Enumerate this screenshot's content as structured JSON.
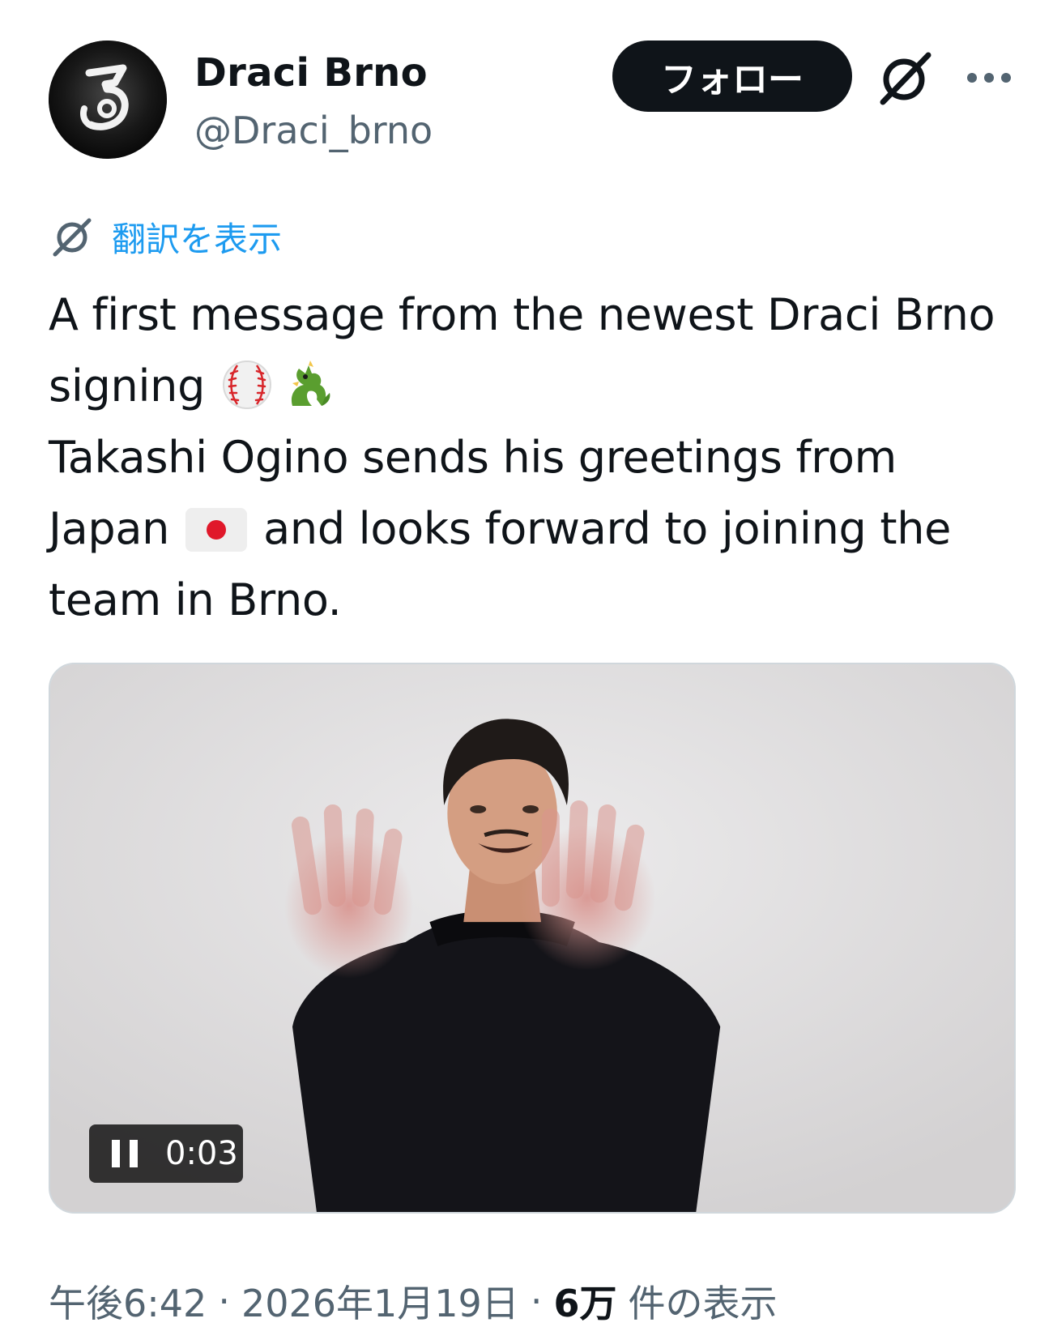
{
  "author": {
    "display_name": "Draci Brno",
    "handle": "@Draci_brno",
    "avatar_icon": "draci-brno-logo"
  },
  "header": {
    "follow_label": "フォロー",
    "grok_icon": "grok-icon",
    "more_icon": "more-horizontal-icon"
  },
  "translate": {
    "icon": "grok-translate-icon",
    "label": "翻訳を表示",
    "color": "#1d9bf0"
  },
  "tweet": {
    "line1": "A first message from the newest Draci Brno",
    "line2": "signing",
    "line3": "Takashi Ogino sends his greetings from",
    "line4_before": "Japan",
    "line4_after": "and looks forward to joining the",
    "line5": "team in Brno.",
    "emojis": [
      "baseball",
      "dragon",
      "flag-japan"
    ]
  },
  "media": {
    "type": "video",
    "state": "playing",
    "control_icon": "pause-icon",
    "elapsed": "0:03"
  },
  "meta": {
    "time": "午後6:42",
    "separator": "·",
    "date": "2026年1月19日",
    "views_count": "6万",
    "views_label": "件の表示"
  },
  "colors": {
    "text_primary": "#0f1419",
    "text_secondary": "#536471",
    "accent": "#1d9bf0",
    "button_bg": "#0f1419"
  }
}
